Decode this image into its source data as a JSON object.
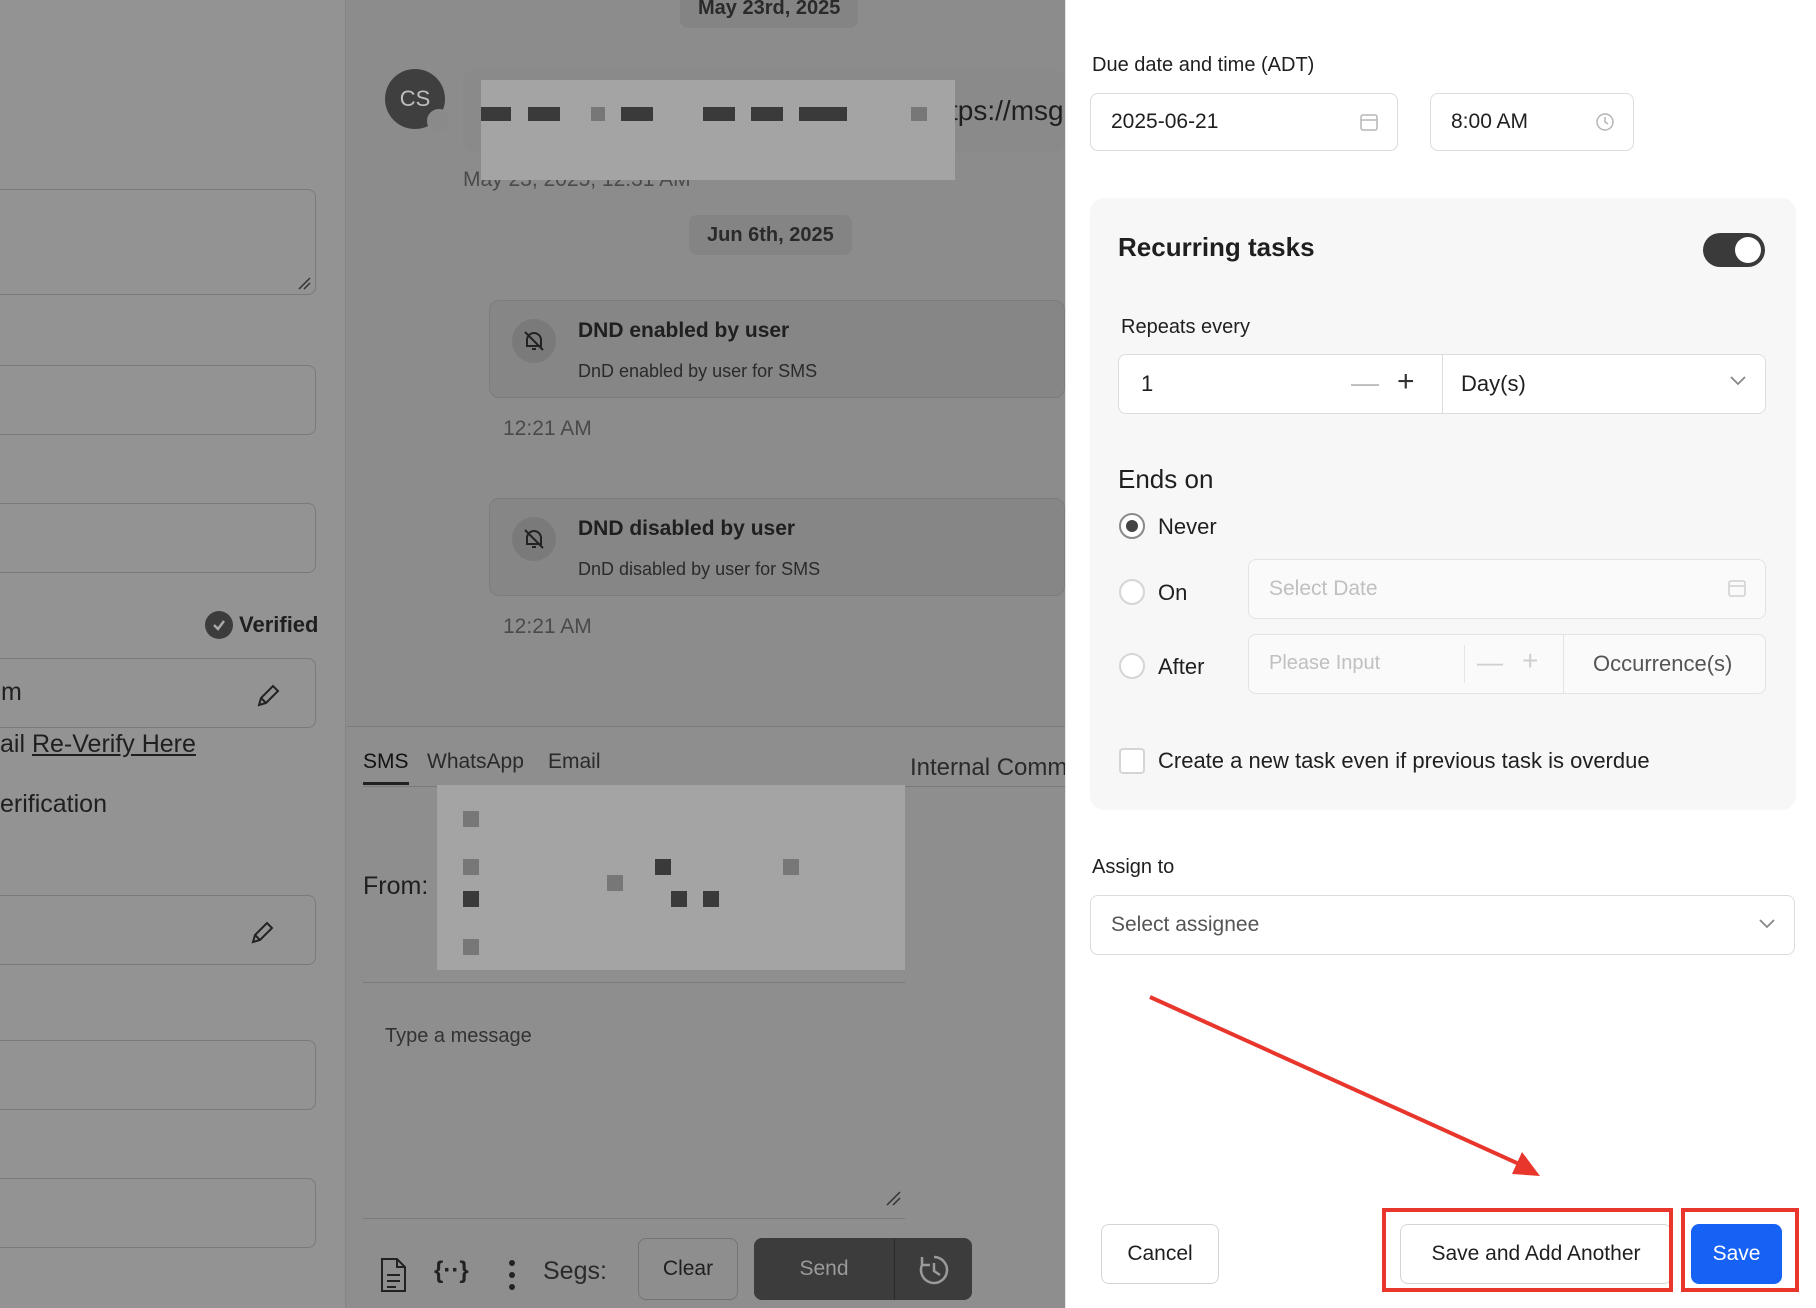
{
  "conversation": {
    "date_1": "May 23rd, 2025",
    "avatar_initials": "CS",
    "message_url_fragment": "tps://msg",
    "message_time": "May 23, 2025, 12:31 AM",
    "date_2": "Jun 6th, 2025",
    "events": [
      {
        "title": "DND enabled by user",
        "detail": "DnD enabled by user for SMS",
        "time": "12:21 AM"
      },
      {
        "title": "DND disabled by user",
        "detail": "DnD disabled by user for SMS",
        "time": "12:21 AM"
      }
    ]
  },
  "left": {
    "verified_label": "Verified",
    "email_value_fragment": "m",
    "reverify_prefix": "ail",
    "reverify_link": "Re-Verify Here",
    "verification_fragment": "erification"
  },
  "compose": {
    "tabs": [
      "SMS",
      "WhatsApp",
      "Email"
    ],
    "internal_tab": "Internal Comm",
    "from_label": "From:",
    "message_placeholder": "Type a message",
    "segs_label": "Segs:",
    "clear_label": "Clear",
    "send_label": "Send"
  },
  "task_panel": {
    "due_label": "Due date and time (ADT)",
    "due_date": "2025-06-21",
    "due_time": "8:00 AM",
    "recurring_title": "Recurring tasks",
    "recurring_enabled": true,
    "repeats_label": "Repeats every",
    "repeat_value": "1",
    "repeat_unit": "Day(s)",
    "ends_title": "Ends on",
    "ends_options": [
      "Never",
      "On",
      "After"
    ],
    "ends_selected": "Never",
    "select_date_placeholder": "Select Date",
    "please_input_placeholder": "Please Input",
    "occurrence_unit": "Occurrence(s)",
    "overdue_checkbox_label": "Create a new task even if previous task is overdue",
    "assign_label": "Assign to",
    "assign_placeholder": "Select assignee",
    "cancel_label": "Cancel",
    "save_add_label": "Save and Add Another",
    "save_label": "Save"
  },
  "colors": {
    "primary": "#1662f5",
    "highlight": "#e8362d",
    "overlay": "#8c8c8c"
  }
}
